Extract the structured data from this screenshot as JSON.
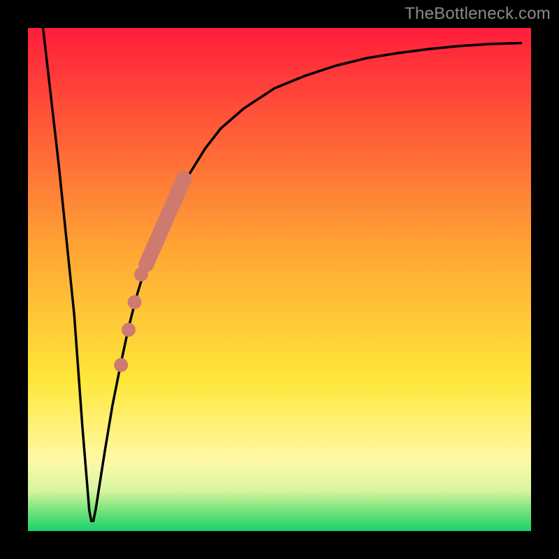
{
  "attribution": "TheBottleneck.com",
  "chart_data": {
    "type": "line",
    "title": "",
    "xlabel": "",
    "ylabel": "",
    "xlim": [
      0,
      100
    ],
    "ylim": [
      0,
      100
    ],
    "background_gradient": {
      "stops": [
        {
          "offset": 0.0,
          "color": "#ff1d3b"
        },
        {
          "offset": 0.45,
          "color": "#ffa834"
        },
        {
          "offset": 0.7,
          "color": "#ffe739"
        },
        {
          "offset": 0.86,
          "color": "#fff9a6"
        },
        {
          "offset": 0.92,
          "color": "#d8f5a0"
        },
        {
          "offset": 0.96,
          "color": "#73e37a"
        },
        {
          "offset": 1.0,
          "color": "#17d36a"
        }
      ]
    },
    "series": [
      {
        "name": "bottleneck-curve",
        "color": "#000000",
        "x": [
          3.0,
          6.1,
          9.2,
          10.8,
          12.2,
          12.6,
          13.0,
          13.5,
          14.2,
          15.3,
          16.8,
          18.4,
          19.9,
          21.4,
          22.9,
          24.5,
          26.8,
          29.1,
          32.1,
          35.2,
          38.3,
          42.9,
          49.0,
          55.1,
          61.2,
          67.3,
          73.5,
          79.6,
          85.7,
          91.8,
          98.0
        ],
        "y": [
          100.0,
          73.0,
          43.0,
          21.0,
          4.0,
          2.0,
          2.0,
          4.5,
          9.0,
          16.0,
          25.0,
          33.0,
          40.0,
          46.0,
          51.0,
          56.0,
          61.0,
          66.0,
          71.0,
          76.0,
          80.0,
          84.0,
          88.0,
          90.5,
          92.5,
          94.0,
          95.0,
          95.8,
          96.4,
          96.8,
          97.0
        ]
      }
    ],
    "highlights": {
      "color": "#cf7a6f",
      "segments": [
        {
          "x_start": 23.5,
          "y_start": 53.0,
          "x_end": 31.0,
          "y_end": 70.0,
          "width": 22
        }
      ],
      "dots": [
        {
          "x": 22.5,
          "y": 51.0,
          "r": 10
        },
        {
          "x": 21.2,
          "y": 45.5,
          "r": 10
        },
        {
          "x": 20.0,
          "y": 40.0,
          "r": 10
        },
        {
          "x": 18.5,
          "y": 33.0,
          "r": 10
        }
      ]
    },
    "frame": {
      "border_color": "#000000",
      "border_width": 40
    }
  }
}
